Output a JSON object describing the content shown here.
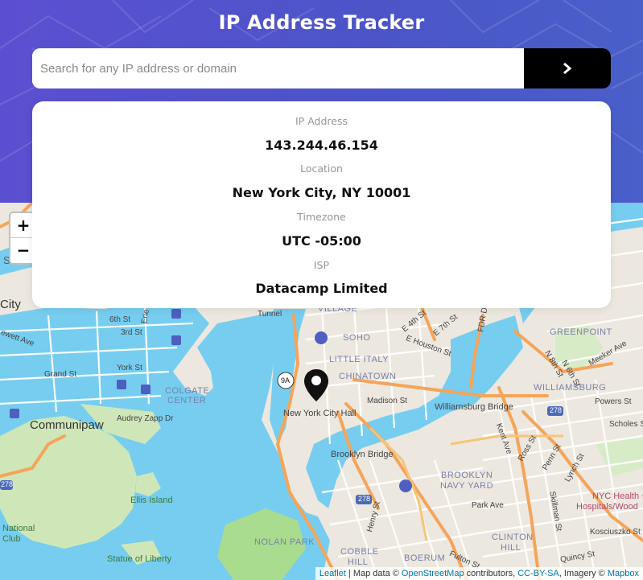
{
  "app": {
    "title": "IP Address Tracker"
  },
  "search": {
    "placeholder": "Search for any IP address or domain",
    "value": ""
  },
  "info": {
    "ip_label": "IP Address",
    "ip_value": "143.244.46.154",
    "location_label": "Location",
    "location_value": "New York City, NY 10001",
    "timezone_label": "Timezone",
    "timezone_value": "UTC -05:00",
    "isp_label": "ISP",
    "isp_value": "Datacamp Limited"
  },
  "map": {
    "zoom_in": "+",
    "zoom_out": "−",
    "labels": {
      "city": "City",
      "section": "Sectio",
      "communipaw": "Communipaw",
      "grand_st": "Grand St",
      "york_st": "York St",
      "audrey_zapp": "Audrey Zapp Dr",
      "colgate_1": "COLGATE",
      "colgate_2": "CENTER",
      "ellis": "Ellis Island",
      "liberty": "Statue of Liberty",
      "national_1": "National",
      "national_2": "Club",
      "nolan": "NOLAN PARK",
      "cobble_1": "COBBLE",
      "cobble_2": "HILL",
      "boerum": "BOERUM",
      "clinton_1": "CLINTON",
      "clinton_2": "HILL",
      "brooklyn_navy_1": "BROOKLYN",
      "brooklyn_navy_2": "NAVY YARD",
      "brooklyn_bridge": "Brooklyn Bridge",
      "williamsburg_bridge": "Williamsburg Bridge",
      "williamsburg": "WILLIAMSBURG",
      "greenpoint": "GREENPOINT",
      "soho": "SOHO",
      "little_italy": "LITTLE ITALY",
      "chinatown": "CHINATOWN",
      "village": "VILLAGE",
      "city_hall": "New York City Hall",
      "madison": "Madison St",
      "houston": "E Houston St",
      "e4": "E 4th St",
      "e7": "E 7th St",
      "meeker": "Meeker Ave",
      "powers": "Powers St",
      "scholes": "Scholes St",
      "park_ave": "Park Ave",
      "nyc_health_1": "NYC Health +",
      "nyc_health_2": "Hospitals/Wood",
      "kent": "Kent Ave",
      "ross": "Ross St",
      "penn": "Penn St",
      "lynch": "Lynch St",
      "kosciuszko": "Kosciuszko St",
      "quincy": "Quincy St",
      "henry": "Henry St",
      "fulton": "Fulton St",
      "skillman": "Skillman St",
      "n8": "N 8th St",
      "n6": "N 6th St",
      "r278a": "278",
      "r278b": "278",
      "r278c": "278",
      "r9a": "9A",
      "tunnel": "Tunnel",
      "fdr": "FDR D",
      "st6": "6th St",
      "st3": "3rd St",
      "erie": "Erie",
      "ewett": "ewett Ave",
      "st4": "4th St"
    },
    "attribution": {
      "leaflet": "Leaflet",
      "sep": " | Map data © ",
      "osm": "OpenStreetMap",
      "contrib": " contributors, ",
      "ccbysa": "CC-BY-SA",
      "imagery": ", Imagery © ",
      "mapbox": "Mapbox"
    }
  },
  "colors": {
    "header_start": "#5b4fd1",
    "header_end": "#4a5fc9",
    "water": "#75cff0",
    "park": "#c8e6b0",
    "highway": "#f5a45a",
    "button": "#000000"
  },
  "icons": [
    "chevron-right-icon",
    "location-pin-icon",
    "transit-icon"
  ]
}
